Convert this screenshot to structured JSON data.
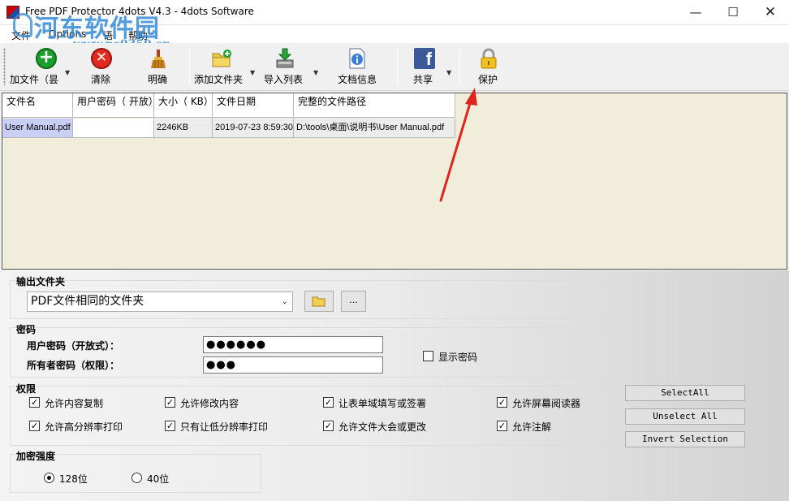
{
  "window": {
    "title": "Free PDF Protector 4dots V4.3 - 4dots Software",
    "minimize_glyph": "—",
    "maximize_glyph": "☐",
    "close_glyph": "✕"
  },
  "watermark": {
    "text": "河东软件园",
    "url": "www.pc0359.cn"
  },
  "menu": {
    "items": [
      "文件",
      "Options",
      "语",
      "帮助"
    ]
  },
  "toolbar": {
    "add_files": "加文件（昙",
    "clear": "清除",
    "clarify": "明确",
    "add_folder": "添加文件夹",
    "import_list": "导入列表",
    "doc_info": "文档信息",
    "share": "共享",
    "protect": "保护",
    "dropdown_glyph": "▼"
  },
  "file_table": {
    "columns": [
      "文件名",
      "用户密码（ 开放）",
      "大小（ KB）",
      "文件日期",
      "完整的文件路径"
    ],
    "rows": [
      [
        "User Manual.pdf",
        "",
        "2246KB",
        "2019-07-23 8:59:30",
        "D:\\tools\\桌面\\说明书\\User Manual.pdf"
      ]
    ]
  },
  "output": {
    "title": "输出文件夹",
    "folder_value": "PDF文件相同的文件夹",
    "browse_label": "...",
    "chevron": "⌄"
  },
  "password": {
    "title": "密码",
    "user_label": "用户密码（开放式）：",
    "user_value": "●●●●●●",
    "owner_label": "所有者密码（权限）：",
    "owner_value": "●●●",
    "show_label": "显示密码",
    "show_checked": false
  },
  "permissions": {
    "title": "权限",
    "items": [
      {
        "label": "允许内容复制",
        "checked": true
      },
      {
        "label": "允许修改内容",
        "checked": true
      },
      {
        "label": "让表单域填写或签署",
        "checked": true
      },
      {
        "label": "允许屏幕阅读器",
        "checked": true
      },
      {
        "label": "允许高分辨率打印",
        "checked": true
      },
      {
        "label": "只有让低分辨率打印",
        "checked": true
      },
      {
        "label": "允许文件大会或更改",
        "checked": true
      },
      {
        "label": "允许注解",
        "checked": true
      }
    ],
    "check_glyph": "✓"
  },
  "selection_buttons": {
    "select_all": "SelectAll",
    "unselect_all": "Unselect All",
    "invert": "Invert Selection"
  },
  "encryption": {
    "title": "加密强度",
    "opt_128": "128位",
    "opt_40": "40位",
    "selected": "128位"
  },
  "colors": {
    "annotation_arrow": "#e0231c",
    "list_background": "#f0eedb",
    "selected_cell": "#c9cff5"
  }
}
